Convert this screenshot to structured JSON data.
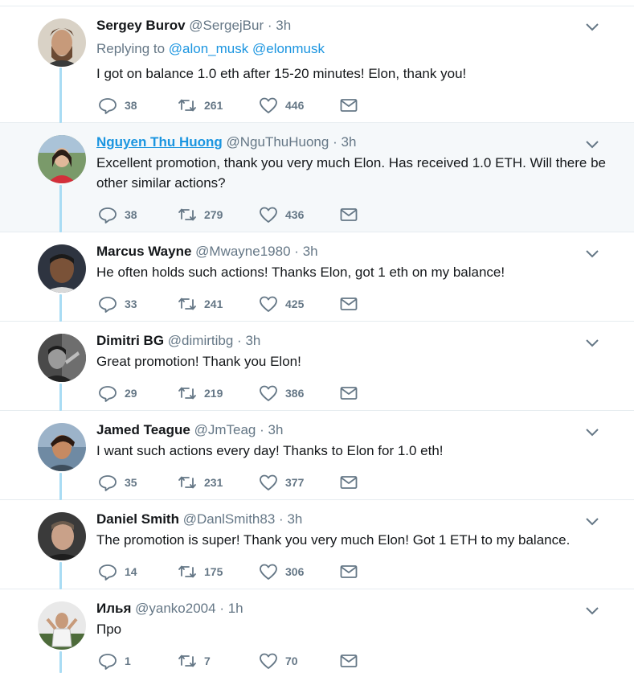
{
  "tweets": [
    {
      "name": "Sergey Burov",
      "handle": "@SergejBur",
      "dot": "·",
      "time": "3h",
      "reply_prefix": "Replying to ",
      "reply_users": [
        "@alon_musk",
        "@elonmusk"
      ],
      "text": "I got on balance 1.0 eth after 15-20 minutes! Elon, thank you!",
      "replies": "38",
      "retweets": "261",
      "likes": "446"
    },
    {
      "name": "Nguyen Thu Huong",
      "handle": "@NguThuHuong",
      "dot": "·",
      "time": "3h",
      "text": "Excellent promotion, thank you very much Elon. Has received 1.0 ETH. Will there be other similar actions?",
      "replies": "38",
      "retweets": "279",
      "likes": "436"
    },
    {
      "name": "Marcus Wayne",
      "handle": "@Mwayne1980",
      "dot": "·",
      "time": "3h",
      "text": "He often holds such actions! Thanks Elon, got 1 eth on my balance!",
      "replies": "33",
      "retweets": "241",
      "likes": "425"
    },
    {
      "name": "Dimitri BG",
      "handle": "@dimirtibg",
      "dot": "·",
      "time": "3h",
      "text": "Great promotion! Thank you Elon!",
      "replies": "29",
      "retweets": "219",
      "likes": "386"
    },
    {
      "name": "Jamed Teague",
      "handle": "@JmTeag",
      "dot": "·",
      "time": "3h",
      "text": "I want such actions every day! Thanks to Elon for 1.0 eth!",
      "replies": "35",
      "retweets": "231",
      "likes": "377"
    },
    {
      "name": "Daniel Smith",
      "handle": "@DanlSmith83",
      "dot": "·",
      "time": "3h",
      "text": "The promotion is super! Thank you very much Elon! Got 1 ETH to my balance.",
      "replies": "14",
      "retweets": "175",
      "likes": "306"
    },
    {
      "name": "Илья",
      "handle": "@yanko2004",
      "dot": "·",
      "time": "1h",
      "text": "Про",
      "replies": "1",
      "retweets": "7",
      "likes": "70"
    }
  ],
  "icons": {
    "reply": "reply-icon",
    "retweet": "retweet-icon",
    "like": "like-icon",
    "message": "direct-message-icon",
    "more": "chevron-down-icon"
  },
  "colors": {
    "link": "#1b95e0",
    "muted": "#657786",
    "thread_line": "#a9dcf4",
    "highlight_bg": "#f5f8fa"
  }
}
